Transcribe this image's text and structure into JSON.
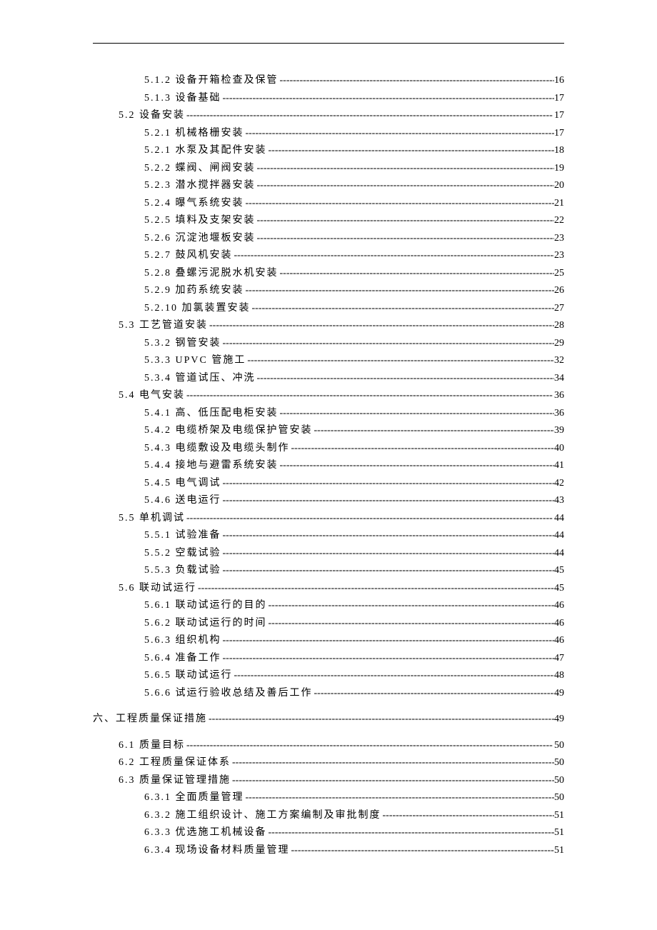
{
  "toc": [
    {
      "level": 3,
      "label": "5.1.2 设备开箱检查及保管",
      "page": "16"
    },
    {
      "level": 3,
      "label": "5.1.3 设备基础",
      "page": "17"
    },
    {
      "level": 2,
      "label": "5.2 设备安装",
      "page": "17"
    },
    {
      "level": 3,
      "label": "5.2.1 机械格栅安装",
      "page": "17"
    },
    {
      "level": 3,
      "label": "5.2.1 水泵及其配件安装",
      "page": "18"
    },
    {
      "level": 3,
      "label": "5.2.2 蝶阀、闸阀安装",
      "page": "19"
    },
    {
      "level": 3,
      "label": "5.2.3 潜水搅拌器安装",
      "page": "20"
    },
    {
      "level": 3,
      "label": "5.2.4 曝气系统安装",
      "page": "21"
    },
    {
      "level": 3,
      "label": "5.2.5 填料及支架安装",
      "page": "22"
    },
    {
      "level": 3,
      "label": "5.2.6 沉淀池堰板安装",
      "page": "23"
    },
    {
      "level": 3,
      "label": "5.2.7 鼓风机安装",
      "page": "23"
    },
    {
      "level": 3,
      "label": "5.2.8 叠螺污泥脱水机安装",
      "page": "25"
    },
    {
      "level": 3,
      "label": "5.2.9 加药系统安装",
      "page": "26"
    },
    {
      "level": 3,
      "label": "5.2.10 加氯装置安装",
      "page": "27"
    },
    {
      "level": 2,
      "label": "5.3 工艺管道安装",
      "page": "28"
    },
    {
      "level": 3,
      "label": "5.3.2 钢管安装",
      "page": "29"
    },
    {
      "level": 3,
      "label": "5.3.3 UPVC 管施工",
      "page": "32"
    },
    {
      "level": 3,
      "label": "5.3.4 管道试压、冲洗",
      "page": "34"
    },
    {
      "level": 2,
      "label": "5.4 电气安装",
      "page": "36"
    },
    {
      "level": 3,
      "label": "5.4.1 高、低压配电柜安装",
      "page": "36"
    },
    {
      "level": 3,
      "label": "5.4.2 电缆桥架及电缆保护管安装",
      "page": "39"
    },
    {
      "level": 3,
      "label": "5.4.3 电缆敷设及电缆头制作",
      "page": "40"
    },
    {
      "level": 3,
      "label": "5.4.4 接地与避雷系统安装",
      "page": "41"
    },
    {
      "level": 3,
      "label": "5.4.5 电气调试",
      "page": "42"
    },
    {
      "level": 3,
      "label": "5.4.6 送电运行",
      "page": "43"
    },
    {
      "level": 2,
      "label": "5.5 单机调试",
      "page": "44"
    },
    {
      "level": 3,
      "label": "5.5.1 试验准备",
      "page": "44"
    },
    {
      "level": 3,
      "label": "5.5.2 空载试验",
      "page": "44"
    },
    {
      "level": 3,
      "label": "5.5.3 负载试验",
      "page": "45"
    },
    {
      "level": 2,
      "label": "5.6 联动试运行",
      "page": "45"
    },
    {
      "level": 3,
      "label": "5.6.1 联动试运行的目的",
      "page": "46"
    },
    {
      "level": 3,
      "label": "5.6.2 联动试运行的时间",
      "page": "46"
    },
    {
      "level": 3,
      "label": "5.6.3 组织机构",
      "page": "46"
    },
    {
      "level": 3,
      "label": "5.6.4 准备工作",
      "page": "47"
    },
    {
      "level": 3,
      "label": "5.6.5 联动试运行",
      "page": "48"
    },
    {
      "level": 3,
      "label": "5.6.6 试运行验收总结及善后工作",
      "page": "49"
    },
    {
      "level": 0,
      "gap": true
    },
    {
      "level": 1,
      "label": "六、工程质量保证措施",
      "page": "49"
    },
    {
      "level": 0,
      "gap": true
    },
    {
      "level": 2,
      "label": "6.1 质量目标",
      "page": "50"
    },
    {
      "level": 2,
      "label": "6.2 工程质量保证体系",
      "page": "50"
    },
    {
      "level": 2,
      "label": "6.3 质量保证管理措施",
      "page": "50"
    },
    {
      "level": 3,
      "label": "6.3.1 全面质量管理",
      "page": "50"
    },
    {
      "level": 3,
      "label": "6.3.2 施工组织设计、施工方案编制及审批制度",
      "page": "51"
    },
    {
      "level": 3,
      "label": "6.3.3 优选施工机械设备",
      "page": "51"
    },
    {
      "level": 3,
      "label": "6.3.4 现场设备材料质量管理",
      "page": "51"
    }
  ]
}
